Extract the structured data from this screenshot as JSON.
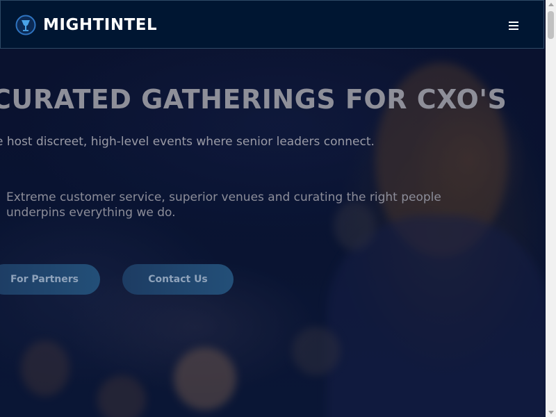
{
  "navbar": {
    "brand": "MIGHTINTEL",
    "logo_icon": "wine-glass-icon",
    "menu_icon": "hamburger-icon"
  },
  "hero": {
    "title": "CURATED GATHERINGS FOR CXO'S",
    "subtitle": "e host discreet, high-level events where senior leaders connect.",
    "paragraph": "Extreme customer service, superior venues and curating the right people underpins everything we do.",
    "buttons": {
      "partners": "For Partners",
      "contact": "Contact Us"
    }
  },
  "colors": {
    "navbar_bg": "#001632",
    "accent": "#234f78",
    "hero_text": "#8e8f99"
  }
}
